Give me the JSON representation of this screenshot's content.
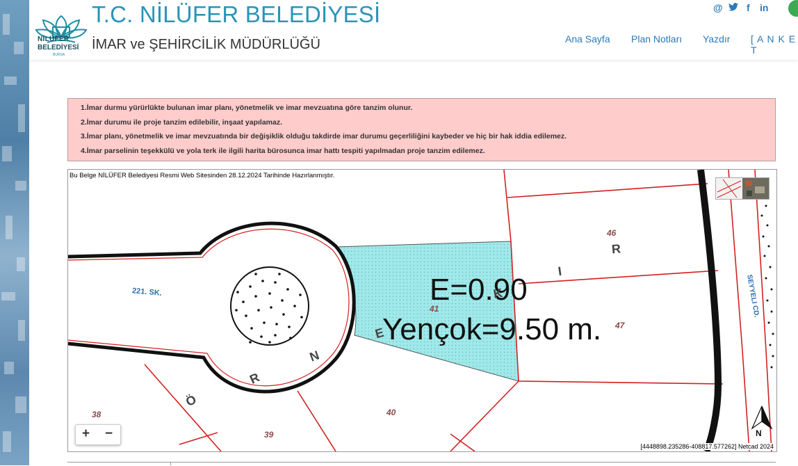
{
  "header": {
    "title": "T.C. NİLÜFER BELEDİYESİ",
    "subtitle": "İMAR ve ŞEHİRCİLİK MÜDÜRLÜĞÜ",
    "logo_line1": "NİLÜFER",
    "logo_line2": "BELEDİYESİ",
    "logo_line3": "BURSA"
  },
  "social": {
    "at": "@",
    "twitter": "🐦",
    "facebook": "f",
    "linkedin": "in"
  },
  "nav": {
    "home": "Ana Sayfa",
    "plan_notes": "Plan Notları",
    "print": "Yazdır",
    "survey": "[ A N K E T"
  },
  "notice": {
    "items": [
      "1.İmar durmu yürürlükte bulunan imar planı, yönetmelik ve imar mevzuatına göre tanzim olunur.",
      "2.İmar durumu ile proje tanzim edilebilir, inşaat yapılamaz.",
      "3.İmar planı, yönetmelik ve imar mevzuatında bir değişiklik olduğu takdirde imar durumu geçerliliğini kaybeder ve hiç bir hak iddia edilemez.",
      "4.İmar parselinin teşekkülü ve yola terk ile ilgili harita bürosunca imar hattı tespiti yapılmadan proje tanzim edilemez."
    ]
  },
  "map": {
    "caption": "Bu Belge NİLÜFER Belediyesi Resmi Web Sitesinden 28.12.2024 Tarihinde Hazırlanmıştır.",
    "street_left": "221. SK.",
    "street_right": "SEYYELI CD.",
    "far": "E=0.90",
    "height": "Yençok=9.50 m.",
    "parcel_41": "41",
    "parcel_46": "46",
    "parcel_47": "47",
    "parcel_38": "38",
    "parcel_39": "39",
    "parcel_40": "40",
    "letters": [
      "Ö",
      "R",
      "N",
      "E",
      "K",
      "I",
      "R"
    ],
    "north": "N",
    "coords": "[4448898.235286-408817.577262] Netcad 2024",
    "zoom_in": "+",
    "zoom_out": "−"
  },
  "colors": {
    "title": "#2b94b8",
    "nav": "#2b7ab8",
    "notice_bg": "#ffcccc",
    "parcel_fill": "#9fe9ea",
    "parcel_border": "#d42020"
  }
}
